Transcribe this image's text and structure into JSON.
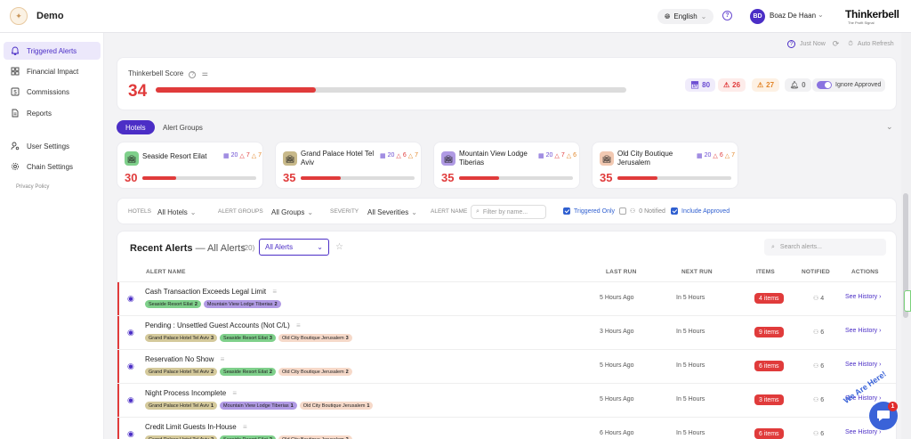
{
  "header": {
    "app_name": "Demo",
    "language": "English",
    "help_icon": "?",
    "avatar_initials": "BD",
    "user_name": "Boaz De Haan",
    "brand": "Thinkerbell",
    "brand_tagline": "The Profit Signal"
  },
  "sidebar": {
    "items": [
      {
        "label": "Triggered Alerts",
        "icon": "bell-icon",
        "active": true
      },
      {
        "label": "Financial Impact",
        "icon": "grid-icon"
      },
      {
        "label": "Commissions",
        "icon": "dollar-icon"
      },
      {
        "label": "Reports",
        "icon": "document-icon"
      },
      {
        "label": "User Settings",
        "icon": "user-gear-icon"
      },
      {
        "label": "Chain Settings",
        "icon": "gear-icon"
      }
    ],
    "privacy": "Privacy Policy"
  },
  "refresh": {
    "just_now": "Just Now",
    "auto_refresh": "Auto Refresh"
  },
  "score_card": {
    "label": "Thinkerbell Score",
    "score": "34",
    "score_fraction": 0.34,
    "pills": [
      {
        "value": "80",
        "icon": "calendar-icon",
        "color": "#6a4bd1",
        "bg": "#f0ecfb"
      },
      {
        "value": "26",
        "icon": "alert-icon",
        "color": "#e03b3b",
        "bg": "#fdecea"
      },
      {
        "value": "27",
        "icon": "warning-icon",
        "color": "#e2862a",
        "bg": "#fdf1e4"
      },
      {
        "value": "0",
        "icon": "bell-icon",
        "color": "#777777",
        "bg": "#f1f1f3"
      }
    ],
    "ignore_approved": "Ignore Approved"
  },
  "tabs": [
    {
      "label": "Hotels",
      "active": true
    },
    {
      "label": "Alert Groups",
      "active": false
    }
  ],
  "hotels": [
    {
      "name": "Seaside Resort Eilat",
      "score": "30",
      "fraction": 0.3,
      "cal": "20",
      "alert": "7",
      "warn": "7",
      "icon_bg": "#7fd08b"
    },
    {
      "name": "Grand Palace Hotel Tel Aviv",
      "score": "35",
      "fraction": 0.35,
      "cal": "20",
      "alert": "6",
      "warn": "7",
      "icon_bg": "#c8b98a"
    },
    {
      "name": "Mountain View Lodge Tiberias",
      "score": "35",
      "fraction": 0.35,
      "cal": "20",
      "alert": "7",
      "warn": "6",
      "icon_bg": "#b09ae4"
    },
    {
      "name": "Old City Boutique Jerusalem",
      "score": "35",
      "fraction": 0.35,
      "cal": "20",
      "alert": "6",
      "warn": "7",
      "icon_bg": "#f2c9b2"
    }
  ],
  "filters": {
    "hotels_label": "HOTELS",
    "hotels_value": "All Hotels",
    "groups_label": "ALERT GROUPS",
    "groups_value": "All Groups",
    "severity_label": "SEVERITY",
    "severity_value": "All Severities",
    "name_label": "ALERT NAME",
    "name_placeholder": "Filter by name...",
    "triggered_only": "Triggered Only",
    "zero_notified": "0 Notified",
    "include_approved": "Include Approved"
  },
  "alerts": {
    "title": "Recent Alerts",
    "subtitle": "— All Alerts",
    "count": "(20)",
    "select_value": "All Alerts",
    "search_placeholder": "Search alerts...",
    "columns": {
      "name": "ALERT NAME",
      "last_run": "LAST RUN",
      "next_run": "NEXT RUN",
      "items": "ITEMS",
      "notified": "NOTIFIED",
      "actions": "ACTIONS"
    },
    "rows": [
      {
        "name": "Cash Transaction Exceeds Legal Limit",
        "tags": [
          {
            "label": "Seaside Resort Eilat",
            "count": "2",
            "bg": "#7fd08b"
          },
          {
            "label": "Mountain View Lodge Tiberias",
            "count": "2",
            "bg": "#b09ae4"
          }
        ],
        "last_run": "5 Hours Ago",
        "next_run": "In 5 Hours",
        "items": "4 items",
        "notified": "4",
        "action": "See History"
      },
      {
        "name": "Pending : Unsettled Guest Accounts (Not C/L)",
        "tags": [
          {
            "label": "Grand Palace Hotel Tel Aviv",
            "count": "3",
            "bg": "#d4c99b"
          },
          {
            "label": "Seaside Resort Eilat",
            "count": "3",
            "bg": "#7fd08b"
          },
          {
            "label": "Old City Boutique Jerusalem",
            "count": "3",
            "bg": "#f6d9c9"
          }
        ],
        "last_run": "3 Hours Ago",
        "next_run": "In 5 Hours",
        "items": "9 items",
        "notified": "6",
        "action": "See History"
      },
      {
        "name": "Reservation No Show",
        "tags": [
          {
            "label": "Grand Palace Hotel Tel Aviv",
            "count": "2",
            "bg": "#d4c99b"
          },
          {
            "label": "Seaside Resort Eilat",
            "count": "2",
            "bg": "#7fd08b"
          },
          {
            "label": "Old City Boutique Jerusalem",
            "count": "2",
            "bg": "#f6d9c9"
          }
        ],
        "last_run": "5 Hours Ago",
        "next_run": "In 5 Hours",
        "items": "6 items",
        "notified": "6",
        "action": "See History"
      },
      {
        "name": "Night Process Incomplete",
        "tags": [
          {
            "label": "Grand Palace Hotel Tel Aviv",
            "count": "1",
            "bg": "#d4c99b"
          },
          {
            "label": "Mountain View Lodge Tiberias",
            "count": "1",
            "bg": "#b09ae4"
          },
          {
            "label": "Old City Boutique Jerusalem",
            "count": "1",
            "bg": "#f6d9c9"
          }
        ],
        "last_run": "5 Hours Ago",
        "next_run": "In 5 Hours",
        "items": "3 items",
        "notified": "6",
        "action": "See History"
      },
      {
        "name": "Credit Limit Guests In-House",
        "tags": [
          {
            "label": "Grand Palace Hotel Tel Aviv",
            "count": "2",
            "bg": "#d4c99b"
          },
          {
            "label": "Seaside Resort Eilat",
            "count": "2",
            "bg": "#7fd08b"
          },
          {
            "label": "Old City Boutique Jerusalem",
            "count": "2",
            "bg": "#f6d9c9"
          }
        ],
        "last_run": "6 Hours Ago",
        "next_run": "In 5 Hours",
        "items": "6 items",
        "notified": "6",
        "action": "See History"
      }
    ]
  },
  "chat": {
    "badge": "1",
    "label": "We Are Here!"
  }
}
